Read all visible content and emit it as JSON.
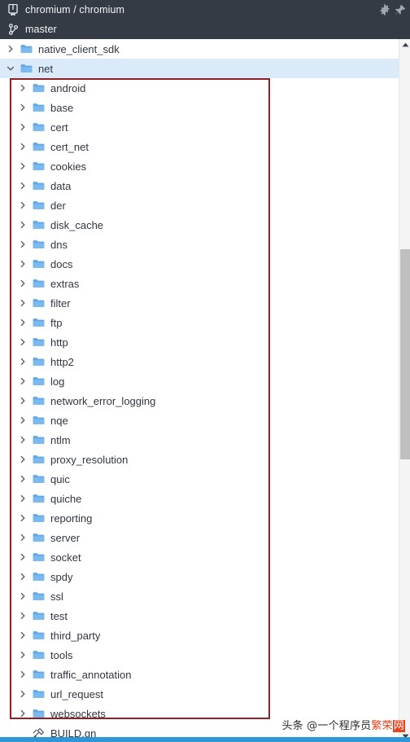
{
  "header": {
    "repo_icon": "repository-icon",
    "repo_name": "chromium / chromium",
    "branch_icon": "git-branch-icon",
    "branch_name": "master",
    "settings_icon": "gear-icon",
    "pin_icon": "pin-icon",
    "background_color": "#353b45"
  },
  "tree": {
    "rows": [
      {
        "label": "native_client_sdk",
        "icon": "folder-icon",
        "twisty": "chevron-right",
        "depth": 1,
        "selected": false,
        "type": "folder"
      },
      {
        "label": "net",
        "icon": "folder-icon",
        "twisty": "chevron-down",
        "depth": 1,
        "selected": true,
        "type": "folder"
      },
      {
        "label": "android",
        "icon": "folder-icon",
        "twisty": "chevron-right",
        "depth": 2,
        "selected": false,
        "type": "folder"
      },
      {
        "label": "base",
        "icon": "folder-icon",
        "twisty": "chevron-right",
        "depth": 2,
        "selected": false,
        "type": "folder"
      },
      {
        "label": "cert",
        "icon": "folder-icon",
        "twisty": "chevron-right",
        "depth": 2,
        "selected": false,
        "type": "folder"
      },
      {
        "label": "cert_net",
        "icon": "folder-icon",
        "twisty": "chevron-right",
        "depth": 2,
        "selected": false,
        "type": "folder"
      },
      {
        "label": "cookies",
        "icon": "folder-icon",
        "twisty": "chevron-right",
        "depth": 2,
        "selected": false,
        "type": "folder"
      },
      {
        "label": "data",
        "icon": "folder-icon",
        "twisty": "chevron-right",
        "depth": 2,
        "selected": false,
        "type": "folder"
      },
      {
        "label": "der",
        "icon": "folder-icon",
        "twisty": "chevron-right",
        "depth": 2,
        "selected": false,
        "type": "folder"
      },
      {
        "label": "disk_cache",
        "icon": "folder-icon",
        "twisty": "chevron-right",
        "depth": 2,
        "selected": false,
        "type": "folder"
      },
      {
        "label": "dns",
        "icon": "folder-icon",
        "twisty": "chevron-right",
        "depth": 2,
        "selected": false,
        "type": "folder"
      },
      {
        "label": "docs",
        "icon": "folder-icon",
        "twisty": "chevron-right",
        "depth": 2,
        "selected": false,
        "type": "folder"
      },
      {
        "label": "extras",
        "icon": "folder-icon",
        "twisty": "chevron-right",
        "depth": 2,
        "selected": false,
        "type": "folder"
      },
      {
        "label": "filter",
        "icon": "folder-icon",
        "twisty": "chevron-right",
        "depth": 2,
        "selected": false,
        "type": "folder"
      },
      {
        "label": "ftp",
        "icon": "folder-icon",
        "twisty": "chevron-right",
        "depth": 2,
        "selected": false,
        "type": "folder"
      },
      {
        "label": "http",
        "icon": "folder-icon",
        "twisty": "chevron-right",
        "depth": 2,
        "selected": false,
        "type": "folder"
      },
      {
        "label": "http2",
        "icon": "folder-icon",
        "twisty": "chevron-right",
        "depth": 2,
        "selected": false,
        "type": "folder"
      },
      {
        "label": "log",
        "icon": "folder-icon",
        "twisty": "chevron-right",
        "depth": 2,
        "selected": false,
        "type": "folder"
      },
      {
        "label": "network_error_logging",
        "icon": "folder-icon",
        "twisty": "chevron-right",
        "depth": 2,
        "selected": false,
        "type": "folder"
      },
      {
        "label": "nqe",
        "icon": "folder-icon",
        "twisty": "chevron-right",
        "depth": 2,
        "selected": false,
        "type": "folder"
      },
      {
        "label": "ntlm",
        "icon": "folder-icon",
        "twisty": "chevron-right",
        "depth": 2,
        "selected": false,
        "type": "folder"
      },
      {
        "label": "proxy_resolution",
        "icon": "folder-icon",
        "twisty": "chevron-right",
        "depth": 2,
        "selected": false,
        "type": "folder"
      },
      {
        "label": "quic",
        "icon": "folder-icon",
        "twisty": "chevron-right",
        "depth": 2,
        "selected": false,
        "type": "folder"
      },
      {
        "label": "quiche",
        "icon": "folder-icon",
        "twisty": "chevron-right",
        "depth": 2,
        "selected": false,
        "type": "folder"
      },
      {
        "label": "reporting",
        "icon": "folder-icon",
        "twisty": "chevron-right",
        "depth": 2,
        "selected": false,
        "type": "folder"
      },
      {
        "label": "server",
        "icon": "folder-icon",
        "twisty": "chevron-right",
        "depth": 2,
        "selected": false,
        "type": "folder"
      },
      {
        "label": "socket",
        "icon": "folder-icon",
        "twisty": "chevron-right",
        "depth": 2,
        "selected": false,
        "type": "folder"
      },
      {
        "label": "spdy",
        "icon": "folder-icon",
        "twisty": "chevron-right",
        "depth": 2,
        "selected": false,
        "type": "folder"
      },
      {
        "label": "ssl",
        "icon": "folder-icon",
        "twisty": "chevron-right",
        "depth": 2,
        "selected": false,
        "type": "folder"
      },
      {
        "label": "test",
        "icon": "folder-icon",
        "twisty": "chevron-right",
        "depth": 2,
        "selected": false,
        "type": "folder"
      },
      {
        "label": "third_party",
        "icon": "folder-icon",
        "twisty": "chevron-right",
        "depth": 2,
        "selected": false,
        "type": "folder"
      },
      {
        "label": "tools",
        "icon": "folder-icon",
        "twisty": "chevron-right",
        "depth": 2,
        "selected": false,
        "type": "folder"
      },
      {
        "label": "traffic_annotation",
        "icon": "folder-icon",
        "twisty": "chevron-right",
        "depth": 2,
        "selected": false,
        "type": "folder"
      },
      {
        "label": "url_request",
        "icon": "folder-icon",
        "twisty": "chevron-right",
        "depth": 2,
        "selected": false,
        "type": "folder"
      },
      {
        "label": "websockets",
        "icon": "folder-icon",
        "twisty": "chevron-right",
        "depth": 2,
        "selected": false,
        "type": "folder"
      },
      {
        "label": "BUILD.gn",
        "icon": "gn-file-icon",
        "twisty": "none",
        "depth": 2,
        "selected": false,
        "type": "file"
      }
    ],
    "selected_highlight_color": "#dbeaf9",
    "folder_color": "#5aa9e6",
    "text_color": "#2f3640"
  },
  "annotation": {
    "name": "red-highlight-box",
    "color": "#8e2226"
  },
  "scrollbar": {
    "up_arrow_icon": "caret-up-icon",
    "down_arrow_icon": "caret-down-icon",
    "thumb_color": "#bfbfbf",
    "track_color": "#f4f4f4"
  },
  "watermark": {
    "prefix": "头条 @一个程序员",
    "highlight": "繁荣",
    "boxed": "网"
  }
}
